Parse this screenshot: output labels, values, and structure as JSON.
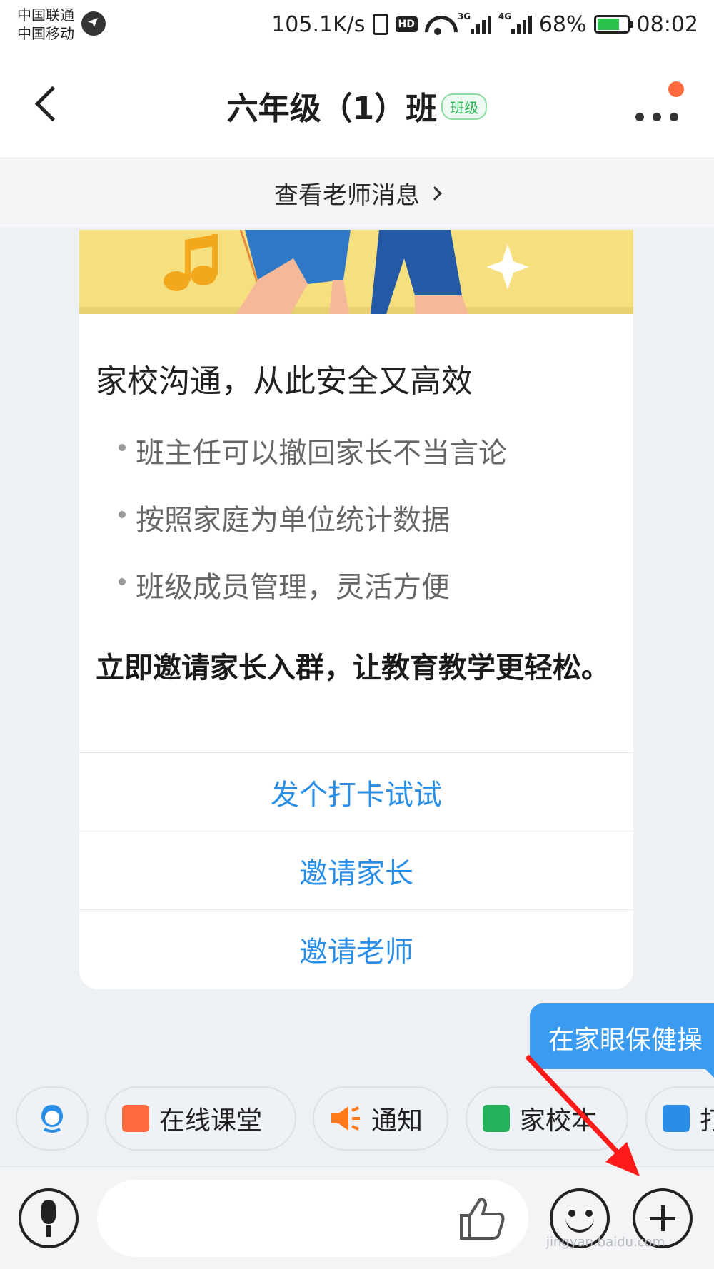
{
  "status_bar": {
    "carrier_1": "中国联通",
    "carrier_2": "中国移动",
    "net_speed": "105.1K/s",
    "hd": "HD",
    "sig1_type": "3G",
    "sig2_type": "4G",
    "battery_pct": "68%",
    "time": "08:02"
  },
  "header": {
    "title": "六年级（1）班",
    "badge": "班级"
  },
  "teacher_messages": {
    "label": "查看老师消息"
  },
  "card": {
    "title": "家校沟通，从此安全又高效",
    "bullets": [
      "班主任可以撤回家长不当言论",
      "按照家庭为单位统计数据",
      "班级成员管理，灵活方便"
    ],
    "invite_text": "立即邀请家长入群，让教育教学更轻松。",
    "actions": [
      "发个打卡试试",
      "邀请家长",
      "邀请老师"
    ]
  },
  "bubble": {
    "text": "在家眼保健操"
  },
  "tools": [
    {
      "label": "",
      "icon": "customer-service-icon"
    },
    {
      "label": "在线课堂",
      "icon": "online-class-icon",
      "color": "#ff6a3d"
    },
    {
      "label": "通知",
      "icon": "megaphone-icon",
      "color": "#ff7a1a"
    },
    {
      "label": "家校本",
      "icon": "notebook-icon",
      "color": "#25b05a"
    },
    {
      "label": "打",
      "icon": "checkin-icon",
      "color": "#2b8ee6"
    }
  ],
  "input": {
    "placeholder": ""
  },
  "watermark": "jingyan.baidu.com",
  "colors": {
    "accent_blue": "#2b8ee6",
    "bubble_blue": "#3a9bf0",
    "badge_green": "#2fb356",
    "annotation_red": "#ff1a1a"
  }
}
